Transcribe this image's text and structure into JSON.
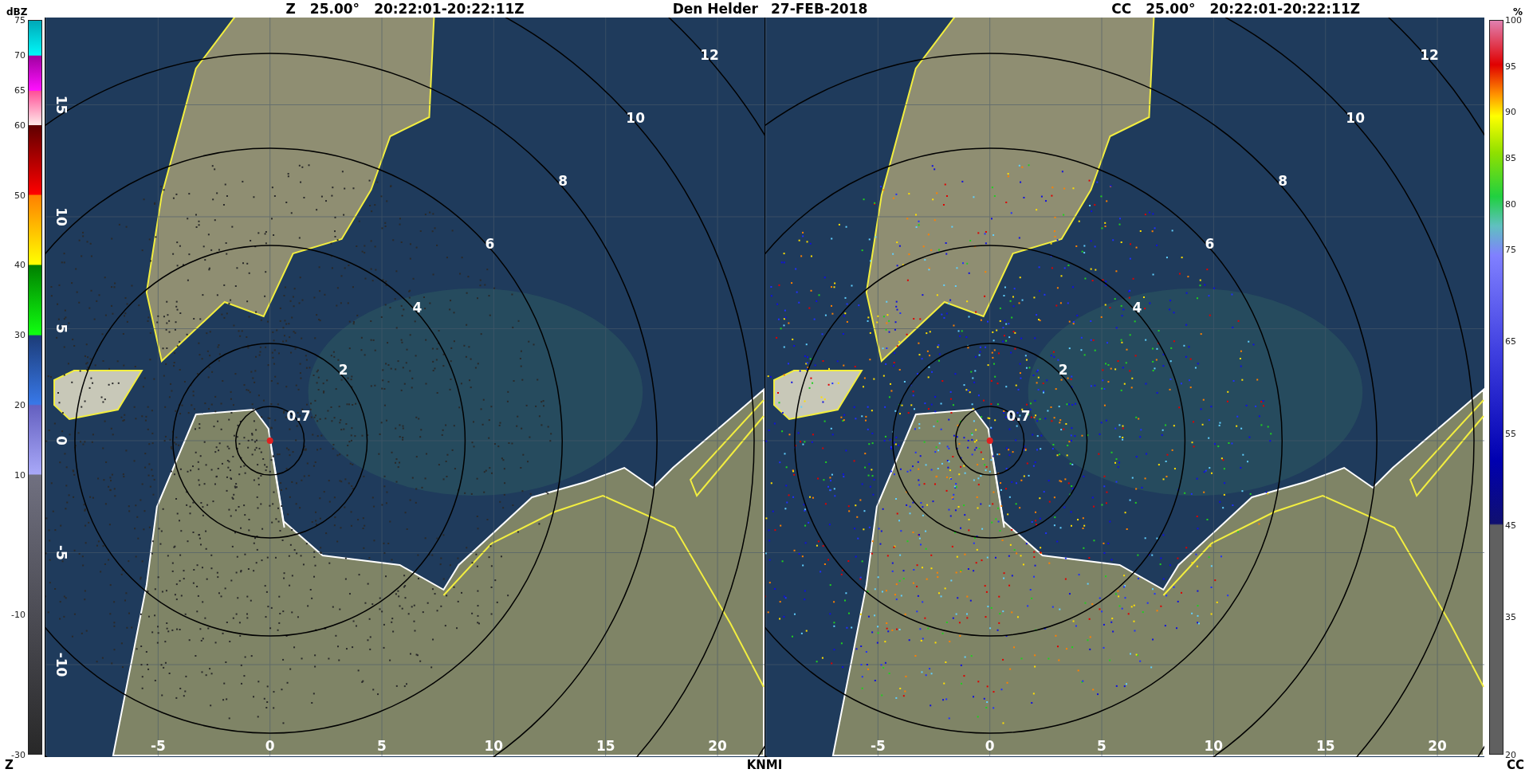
{
  "header": {
    "left_title": [
      "Z",
      "25.00°",
      "20:22:01-20:22:11Z"
    ],
    "station": "Den Helder",
    "date": "27-FEB-2018",
    "right_title": [
      "CC",
      "25.00°",
      "20:22:01-20:22:11Z"
    ]
  },
  "colorbars": [
    {
      "kind": "reflectivity",
      "unit": "dBZ",
      "name": "Z",
      "ticks": [
        "75",
        "70",
        "65",
        "60",
        "50",
        "40",
        "30",
        "20",
        "10",
        "-10",
        "-30"
      ]
    },
    {
      "kind": "correlation",
      "unit": "%",
      "name": "CC",
      "ticks": [
        "100",
        "95",
        "90",
        "85",
        "80",
        "75",
        "65",
        "55",
        "45",
        "35",
        "20"
      ]
    }
  ],
  "panels": [
    {
      "kind": "reflectivity",
      "ring_labels": [
        "0.7",
        "2",
        "4",
        "6",
        "8",
        "10",
        "12"
      ],
      "x_ticks": [
        "-5",
        "0",
        "5",
        "10",
        "15",
        "20"
      ],
      "y_ticks": [
        "15",
        "10",
        "5",
        "0",
        "-5",
        "-10"
      ]
    },
    {
      "kind": "correlation",
      "ring_labels": [
        "0.7",
        "2",
        "4",
        "6",
        "8",
        "10",
        "12"
      ],
      "x_ticks": [
        "-5",
        "0",
        "5",
        "10",
        "15",
        "20"
      ]
    }
  ],
  "footer": {
    "credit": "KNMI"
  }
}
